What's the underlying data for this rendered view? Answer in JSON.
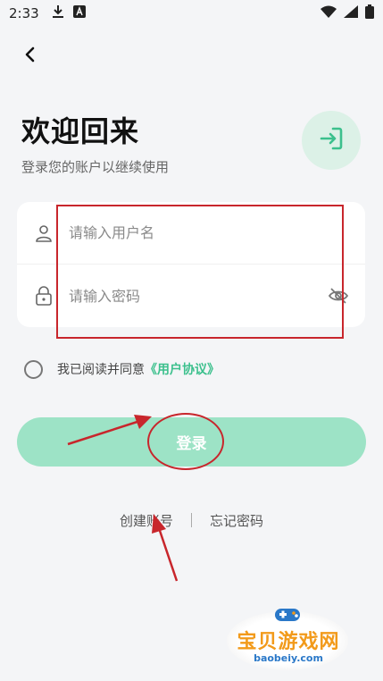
{
  "status_bar": {
    "time": "2:33",
    "icons": [
      "download-icon",
      "a-box-icon",
      "wifi-icon",
      "signal-icon",
      "battery-icon"
    ]
  },
  "header": {
    "back_icon": "chevron-left-icon",
    "title": "欢迎回来",
    "subtitle": "登录您的账户以继续使用",
    "login_icon": "login-arrow-icon"
  },
  "form": {
    "username_placeholder": "请输入用户名",
    "password_placeholder": "请输入密码",
    "username_icon": "user-icon",
    "password_icon": "lock-icon",
    "visibility_icon": "eye-off-icon"
  },
  "agreement": {
    "text": "我已阅读并同意",
    "link": "《用户协议》"
  },
  "actions": {
    "login_label": "登录",
    "create_account": "创建账号",
    "forgot_password": "忘记密码"
  },
  "watermark": {
    "title": "宝贝游戏网",
    "url": "baobeiy.com"
  },
  "colors": {
    "accent": "#3cc08d",
    "button_bg": "#9de3c6",
    "badge_bg": "#dcf1e7",
    "annotation_red": "#c8262c"
  }
}
